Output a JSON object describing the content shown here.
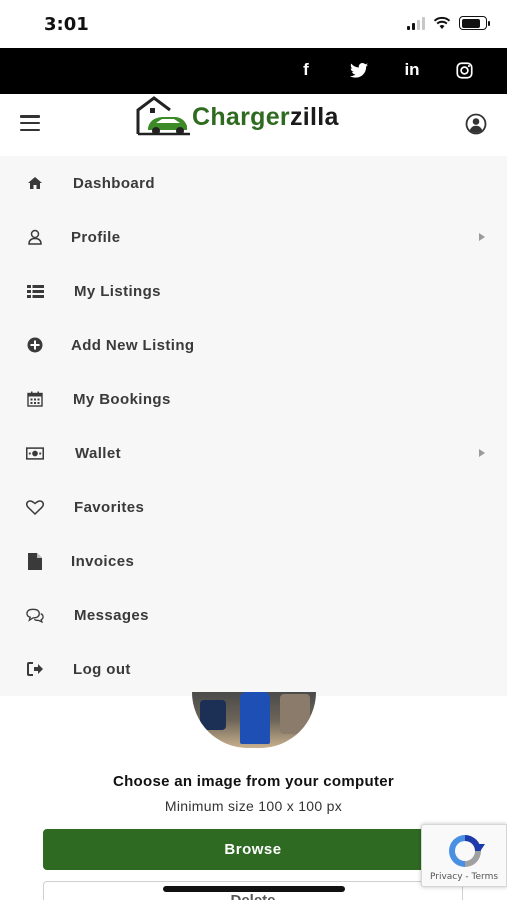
{
  "status_bar": {
    "time": "3:01"
  },
  "social": {
    "facebook": "f",
    "twitter": "twitter-icon",
    "linkedin": "in",
    "instagram": "instagram-icon"
  },
  "header": {
    "logo_part1": "Charger",
    "logo_part2": "zilla",
    "brand_color": "#2e6a1f"
  },
  "menu": {
    "items": [
      {
        "label": "Dashboard",
        "icon": "home-icon",
        "has_submenu": false
      },
      {
        "label": "Profile",
        "icon": "user-icon",
        "has_submenu": true
      },
      {
        "label": "My Listings",
        "icon": "list-icon",
        "has_submenu": false
      },
      {
        "label": "Add New Listing",
        "icon": "plus-circle-icon",
        "has_submenu": false
      },
      {
        "label": "My Bookings",
        "icon": "calendar-icon",
        "has_submenu": false
      },
      {
        "label": "Wallet",
        "icon": "money-icon",
        "has_submenu": true
      },
      {
        "label": "Favorites",
        "icon": "heart-icon",
        "has_submenu": false
      },
      {
        "label": "Invoices",
        "icon": "file-icon",
        "has_submenu": false
      },
      {
        "label": "Messages",
        "icon": "comments-icon",
        "has_submenu": false
      },
      {
        "label": "Log out",
        "icon": "sign-out-icon",
        "has_submenu": false
      }
    ]
  },
  "upload": {
    "title": "Choose an image from your computer",
    "min_size": "Minimum size 100 x 100 px",
    "browse_label": "Browse",
    "delete_label": "Delete",
    "button_color": "#2f6a23"
  },
  "recaptcha": {
    "links": "Privacy - Terms"
  }
}
